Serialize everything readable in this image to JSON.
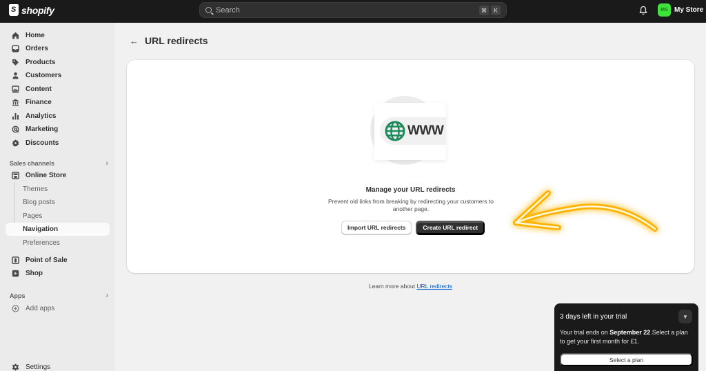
{
  "topbar": {
    "brand": "shopify",
    "search_placeholder": "Search",
    "shortcut_keys": [
      "⌘",
      "K"
    ],
    "avatar_initials": "MS",
    "store_name": "My Store",
    "avatar_color": "#3fe23a"
  },
  "sidebar": {
    "main_items": [
      {
        "label": "Home",
        "icon": "home-icon"
      },
      {
        "label": "Orders",
        "icon": "orders-icon"
      },
      {
        "label": "Products",
        "icon": "tag-icon"
      },
      {
        "label": "Customers",
        "icon": "person-icon"
      },
      {
        "label": "Content",
        "icon": "content-icon"
      },
      {
        "label": "Finance",
        "icon": "bank-icon"
      },
      {
        "label": "Analytics",
        "icon": "bar-chart-icon"
      },
      {
        "label": "Marketing",
        "icon": "target-icon"
      },
      {
        "label": "Discounts",
        "icon": "discount-icon"
      }
    ],
    "sales_channels_heading": "Sales channels",
    "online_store": "Online Store",
    "online_store_sub": [
      "Themes",
      "Blog posts",
      "Pages",
      "Navigation",
      "Preferences"
    ],
    "active_sub": "Navigation",
    "other_channels": [
      {
        "label": "Point of Sale",
        "icon": "pos-icon"
      },
      {
        "label": "Shop",
        "icon": "shop-icon"
      }
    ],
    "apps_heading": "Apps",
    "add_apps": "Add apps",
    "settings": "Settings"
  },
  "main": {
    "page_title": "URL redirects",
    "illustration_text": "WWW",
    "empty_title": "Manage your URL redirects",
    "empty_description": "Prevent old links from breaking by redirecting your customers to another page.",
    "import_button": "Import URL redirects",
    "create_button": "Create URL redirect",
    "learn_prefix": "Learn more about ",
    "learn_link": "URL redirects"
  },
  "trial": {
    "title": "3 days left in your trial",
    "body_prefix": "Your trial ends on ",
    "body_date": "September 22",
    "body_suffix": ".Select a plan to get your first month for £1.",
    "button": "Select a plan"
  },
  "annotation": {
    "arrow_color": "#ffb300"
  }
}
